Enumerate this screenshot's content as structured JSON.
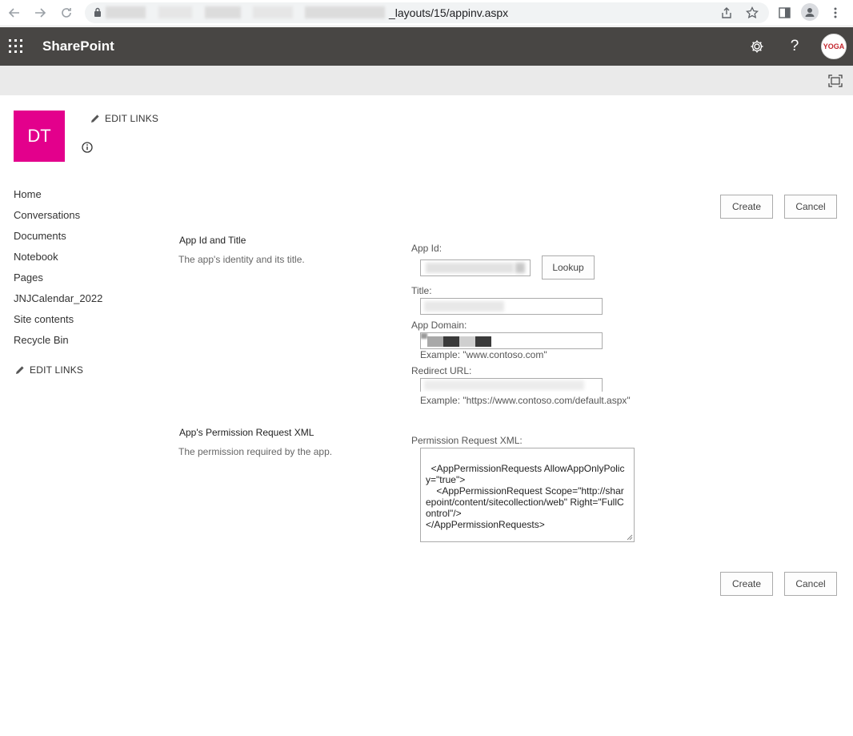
{
  "browser": {
    "url": "_layouts/15/appinv.aspx"
  },
  "suite": {
    "brand": "SharePoint",
    "avatar_text": "YOGA"
  },
  "site": {
    "logo_text": "DT",
    "edit_links": "EDIT LINKS"
  },
  "leftnav": {
    "items": [
      "Home",
      "Conversations",
      "Documents",
      "Notebook",
      "Pages",
      "JNJCalendar_2022",
      "Site contents",
      "Recycle Bin"
    ],
    "edit_links": "EDIT LINKS"
  },
  "actions": {
    "create": "Create",
    "cancel": "Cancel"
  },
  "form": {
    "section1": {
      "title": "App Id and Title",
      "desc": "The app's identity and its title."
    },
    "app_id_label": "App Id:",
    "lookup": "Lookup",
    "title_label": "Title:",
    "app_domain_label": "App Domain:",
    "app_domain_example": "Example: \"www.contoso.com\"",
    "redirect_label": "Redirect URL:",
    "redirect_example": "Example: \"https://www.contoso.com/default.aspx\"",
    "section2": {
      "title": "App's Permission Request XML",
      "desc": "The permission required by the app."
    },
    "xml_label": "Permission Request XML:",
    "xml_value": "<AppPermissionRequests AllowAppOnlyPolicy=\"true\">\n    <AppPermissionRequest Scope=\"http://sharepoint/content/sitecollection/web\" Right=\"FullControl\"/>\n</AppPermissionRequests>"
  }
}
